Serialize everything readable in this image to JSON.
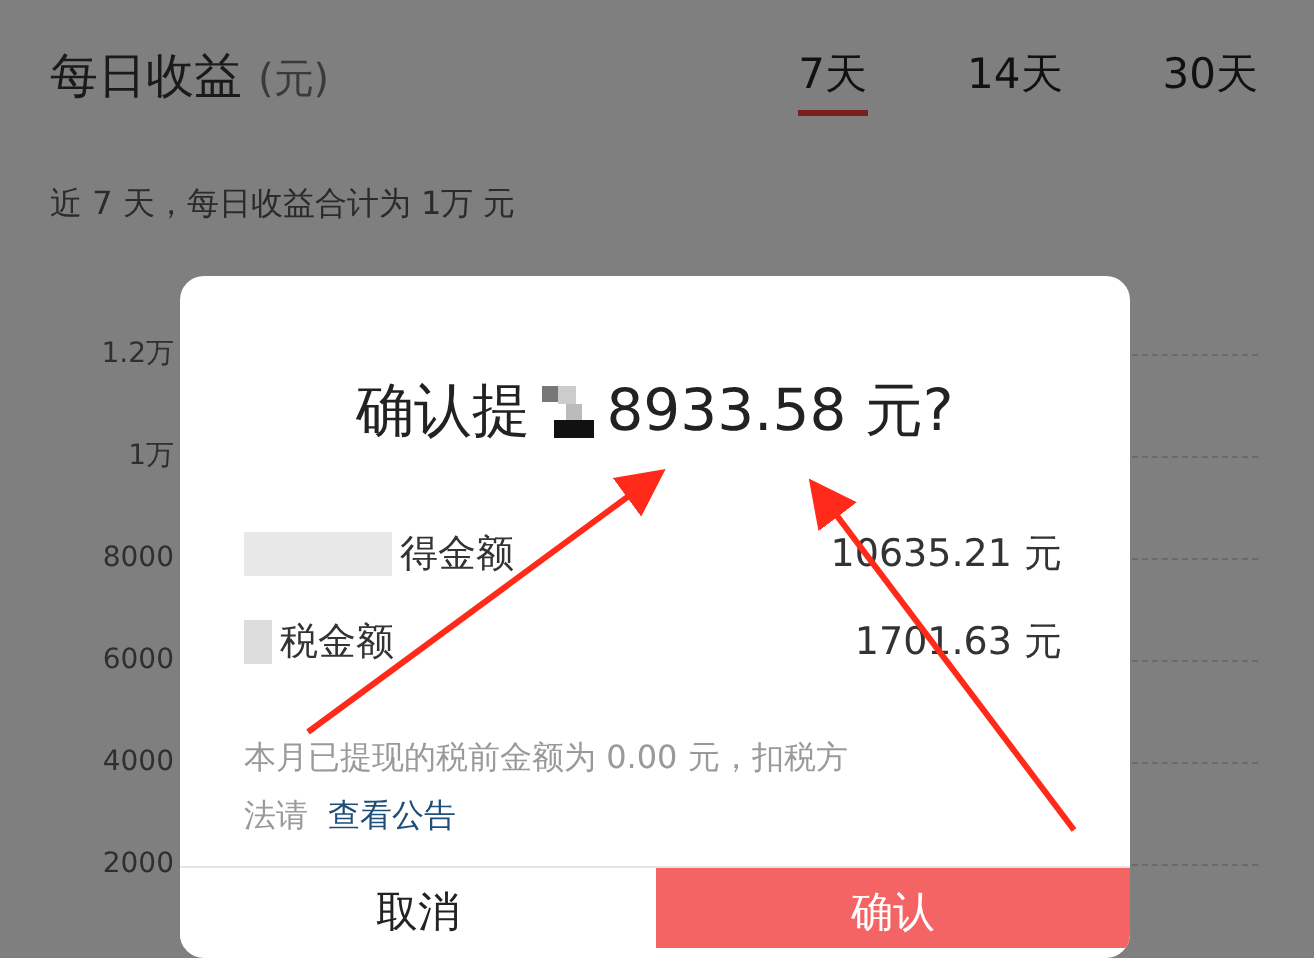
{
  "header": {
    "title": "每日收益",
    "unit": "(元)"
  },
  "tabs": [
    {
      "label": "7天",
      "selected": true
    },
    {
      "label": "14天",
      "selected": false
    },
    {
      "label": "30天",
      "selected": false
    }
  ],
  "summary": "近 7 天，每日收益合计为 1万 元",
  "y_axis_labels": [
    "1.2万",
    "1万",
    "8000",
    "6000",
    "4000",
    "2000"
  ],
  "dialog": {
    "title_start": "确认提",
    "title_amount": "8933.58 元?",
    "rows": [
      {
        "label": "得金额",
        "value": "10635.21 元"
      },
      {
        "label": "税金额",
        "value": "1701.63 元"
      }
    ],
    "note": "本月已提现的税前金额为 0.00 元，扣税方法请",
    "note_link": "查看公告",
    "buttons": [
      {
        "label": "取消",
        "kind": "cancel"
      },
      {
        "label": "确认",
        "kind": "confirm"
      }
    ]
  }
}
